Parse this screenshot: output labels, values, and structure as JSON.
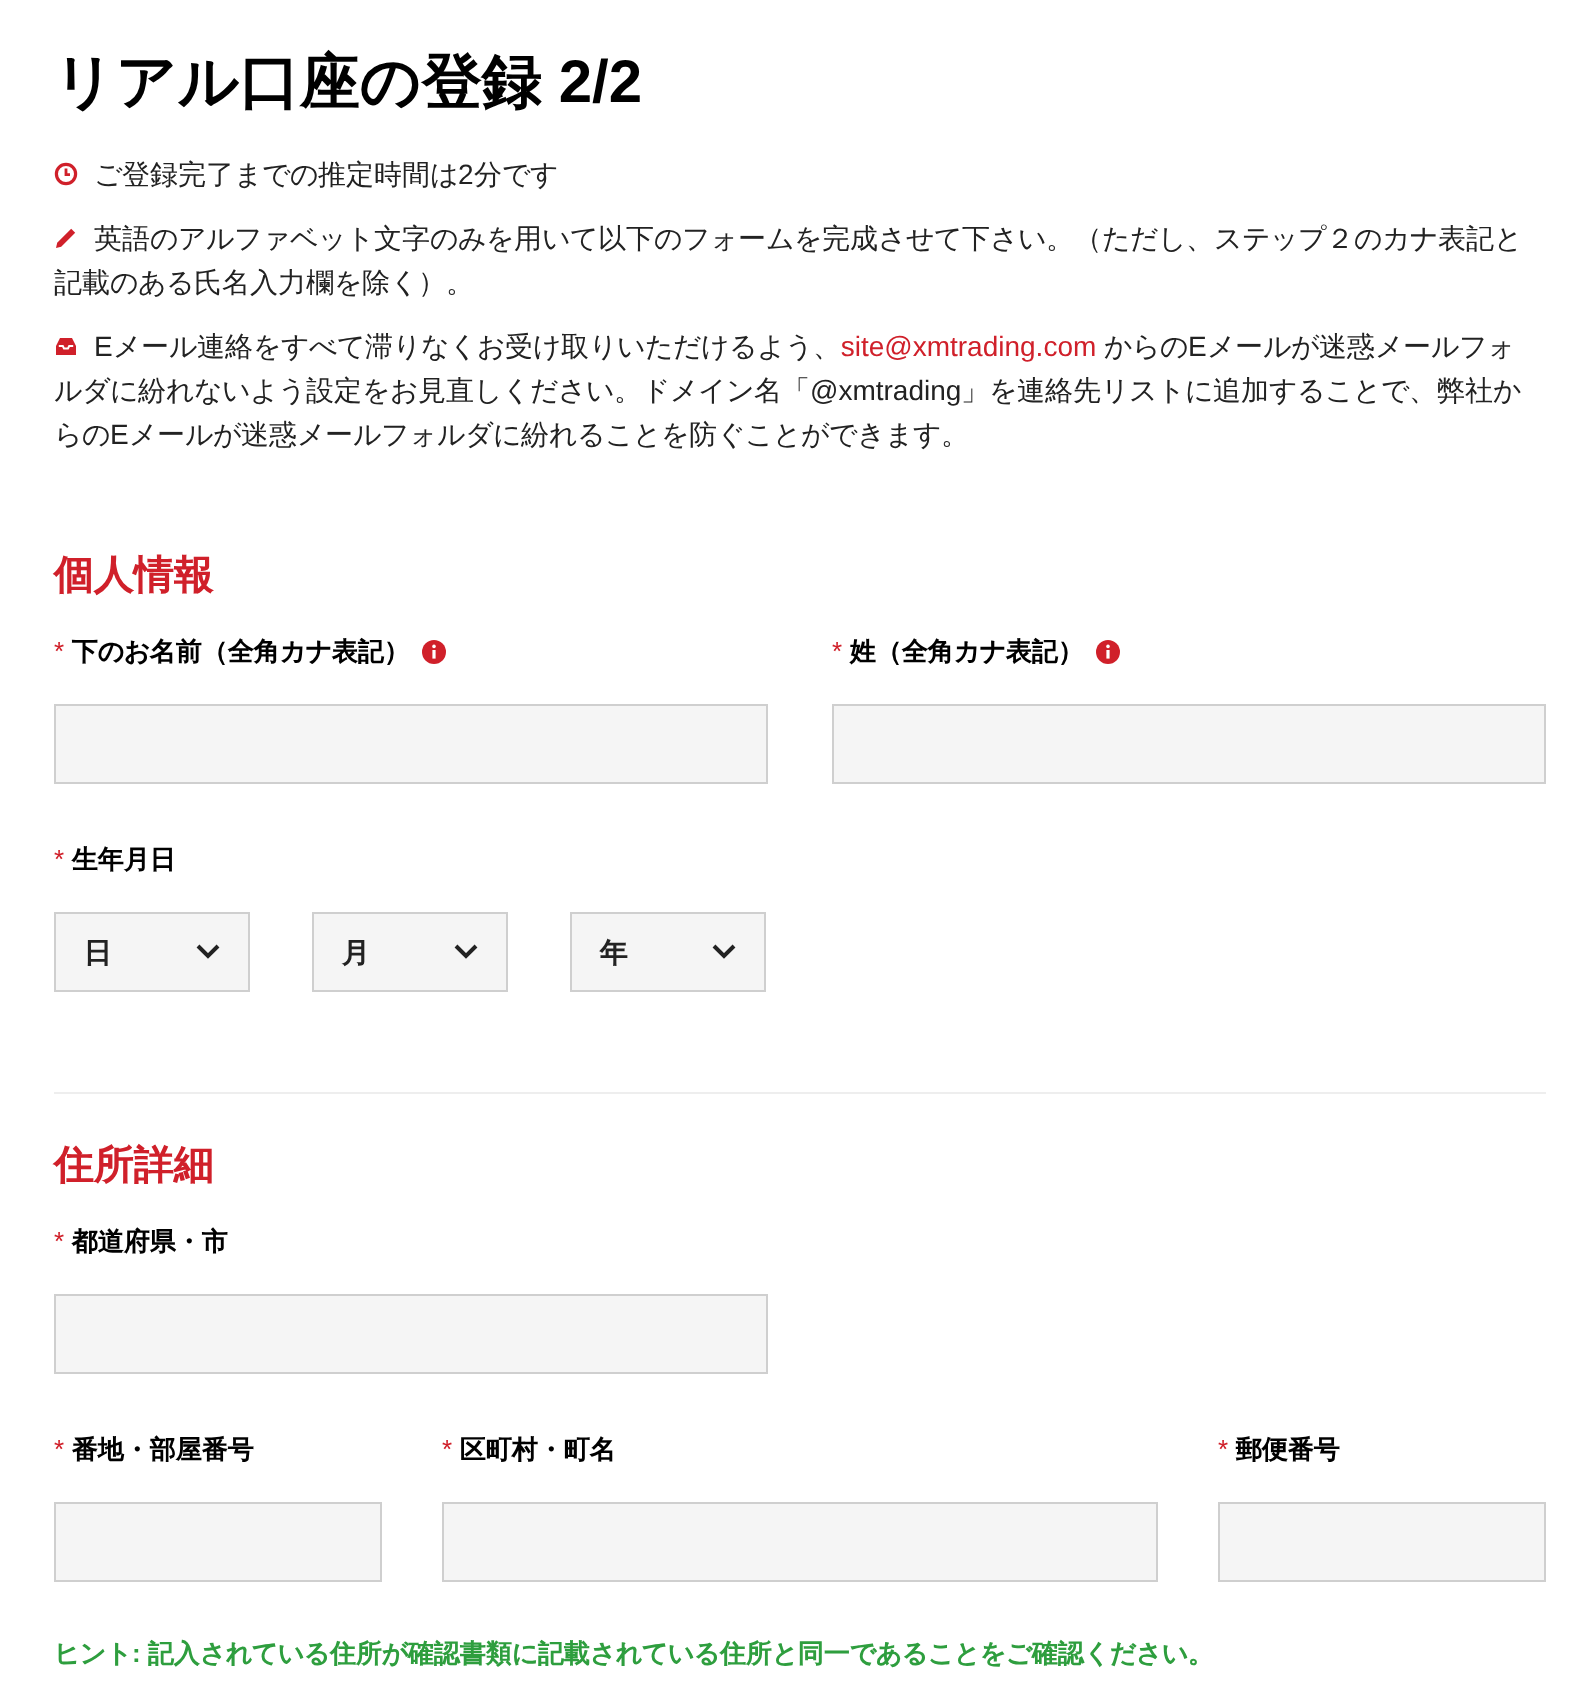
{
  "title": "リアル口座の登録 2/2",
  "notices": [
    {
      "kind": "clock",
      "text": "ご登録完了までの推定時間は2分です"
    },
    {
      "kind": "pencil",
      "text": "英語のアルファベット文字のみを用いて以下のフォームを完成させて下さい。（ただし、ステップ２のカナ表記と記載のある氏名入力欄を除く）。"
    },
    {
      "kind": "inbox",
      "text": "Eメール連絡をすべて滞りなくお受け取りいただけるよう、",
      "link": "site@xmtrading.com",
      "text_after": " からのEメールが迷惑メールフォルダに紛れないよう設定をお見直しください。ドメイン名「@xmtrading」を連絡先リストに追加することで、弊社からのEメールが迷惑メールフォルダに紛れることを防ぐことができます。"
    }
  ],
  "sections": [
    {
      "title": "個人情報",
      "rows": [
        {
          "kind": "pair",
          "fields": [
            {
              "mark": "*",
              "label": "下のお名前（全角カナ表記）",
              "info": true
            },
            {
              "mark": "*",
              "label": "姓（全角カナ表記）",
              "info": true
            }
          ]
        },
        {
          "kind": "selects",
          "mark": "*",
          "label": "生年月日",
          "selects": [
            "日",
            "月",
            "年"
          ]
        }
      ]
    },
    {
      "title": "住所詳細",
      "rows": [
        {
          "kind": "half",
          "fields": [
            {
              "mark": "*",
              "label": "都道府県・市",
              "info": false
            }
          ]
        },
        {
          "kind": "triple",
          "fields": [
            {
              "mark": "*",
              "label": "番地・部屋番号",
              "info": false
            },
            {
              "mark": "*",
              "label": "区町村・町名",
              "info": false
            },
            {
              "mark": "*",
              "label": "郵便番号",
              "info": false
            }
          ]
        }
      ],
      "hint": "ヒント: 記入されている住所が確認書類に記載されている住所と同一であることをご確認ください。"
    }
  ]
}
